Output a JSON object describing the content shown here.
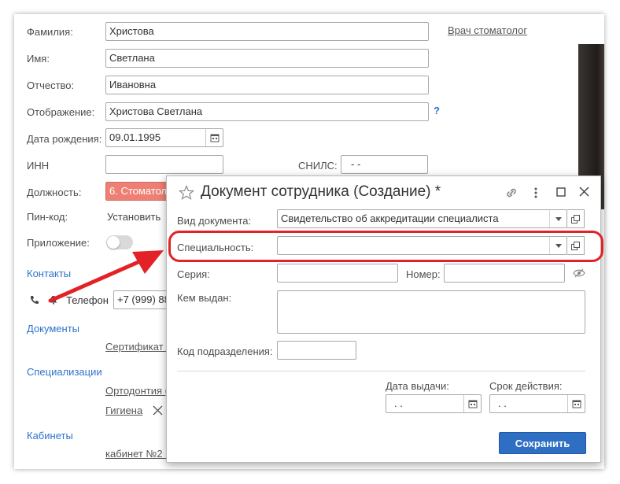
{
  "employee_form": {
    "surname_label": "Фамилия:",
    "surname_value": "Христова",
    "name_label": "Имя:",
    "name_value": "Светлана",
    "patronymic_label": "Отчество:",
    "patronymic_value": "Ивановна",
    "display_label": "Отображение:",
    "display_value": "Христова Светлана",
    "help_mark": "?",
    "birthdate_label": "Дата рождения:",
    "birthdate_value": "09.01.1995",
    "inn_label": "ИНН",
    "inn_value": "",
    "snils_label": "СНИЛС:",
    "snils_value": "-  -",
    "position_label": "Должность:",
    "position_value": "6. Стоматолог",
    "pin_label": "Пин-код:",
    "pin_action": "Установить",
    "app_label": "Приложение:",
    "app_toggle_on": false,
    "role_link": "Врач стоматолог",
    "contacts_section": "Контакты",
    "phone_label": "Телефон",
    "phone_value": "+7 (999) 88",
    "documents_section": "Документы",
    "document_link": "Сертификат в",
    "specializations_section": "Специализации",
    "spec_item_1": "Ортодонтия (",
    "spec_item_2": "Гигиена",
    "cabinets_section": "Кабинеты",
    "cabinet_item": "кабинет №2 к"
  },
  "dialog": {
    "title": "Документ сотрудника (Создание) *",
    "doc_type_label": "Вид документа:",
    "doc_type_value": "Свидетельство об аккредитации специалиста",
    "specialty_label": "Специальность:",
    "specialty_value": "",
    "series_label": "Серия:",
    "series_value": "",
    "number_label": "Номер:",
    "number_value": "",
    "issued_by_label": "Кем выдан:",
    "issued_by_value": "",
    "division_code_label": "Код подразделения:",
    "division_code_value": "",
    "issue_date_label": "Дата выдачи:",
    "issue_date_value": ".  .",
    "validity_label": "Срок действия:",
    "validity_value": ".  .",
    "save_label": "Сохранить"
  },
  "colors": {
    "accent": "#2e6fc4",
    "section_link": "#2f73c9",
    "highlight": "#e32227",
    "position_field": "#ee7f74"
  }
}
